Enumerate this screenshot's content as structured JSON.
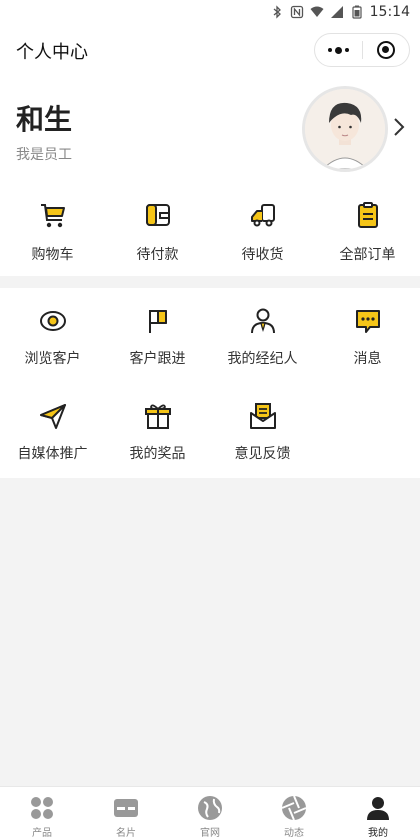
{
  "status_bar": {
    "time": "15:14"
  },
  "navbar": {
    "title": "个人中心"
  },
  "profile": {
    "name": "和生",
    "role": "我是员工"
  },
  "orders": [
    {
      "label": "购物车",
      "icon": "cart-icon"
    },
    {
      "label": "待付款",
      "icon": "wallet-icon"
    },
    {
      "label": "待收货",
      "icon": "truck-icon"
    },
    {
      "label": "全部订单",
      "icon": "clipboard-icon"
    }
  ],
  "services": [
    {
      "label": "浏览客户",
      "icon": "eye-icon"
    },
    {
      "label": "客户跟进",
      "icon": "flag-icon"
    },
    {
      "label": "我的经纪人",
      "icon": "agent-icon"
    },
    {
      "label": "消息",
      "icon": "message-icon"
    },
    {
      "label": "自媒体推广",
      "icon": "send-icon"
    },
    {
      "label": "我的奖品",
      "icon": "gift-icon"
    },
    {
      "label": "意见反馈",
      "icon": "feedback-icon"
    }
  ],
  "tabbar": [
    {
      "label": "产品",
      "icon": "grid-icon",
      "active": false
    },
    {
      "label": "名片",
      "icon": "card-icon",
      "active": false
    },
    {
      "label": "官网",
      "icon": "globe-icon",
      "active": false
    },
    {
      "label": "动态",
      "icon": "aperture-icon",
      "active": false
    },
    {
      "label": "我的",
      "icon": "user-icon",
      "active": true
    }
  ],
  "colors": {
    "accent": "#f5c518",
    "icon_stroke": "#222222",
    "tab_inactive": "#888888",
    "tab_active": "#222222"
  }
}
